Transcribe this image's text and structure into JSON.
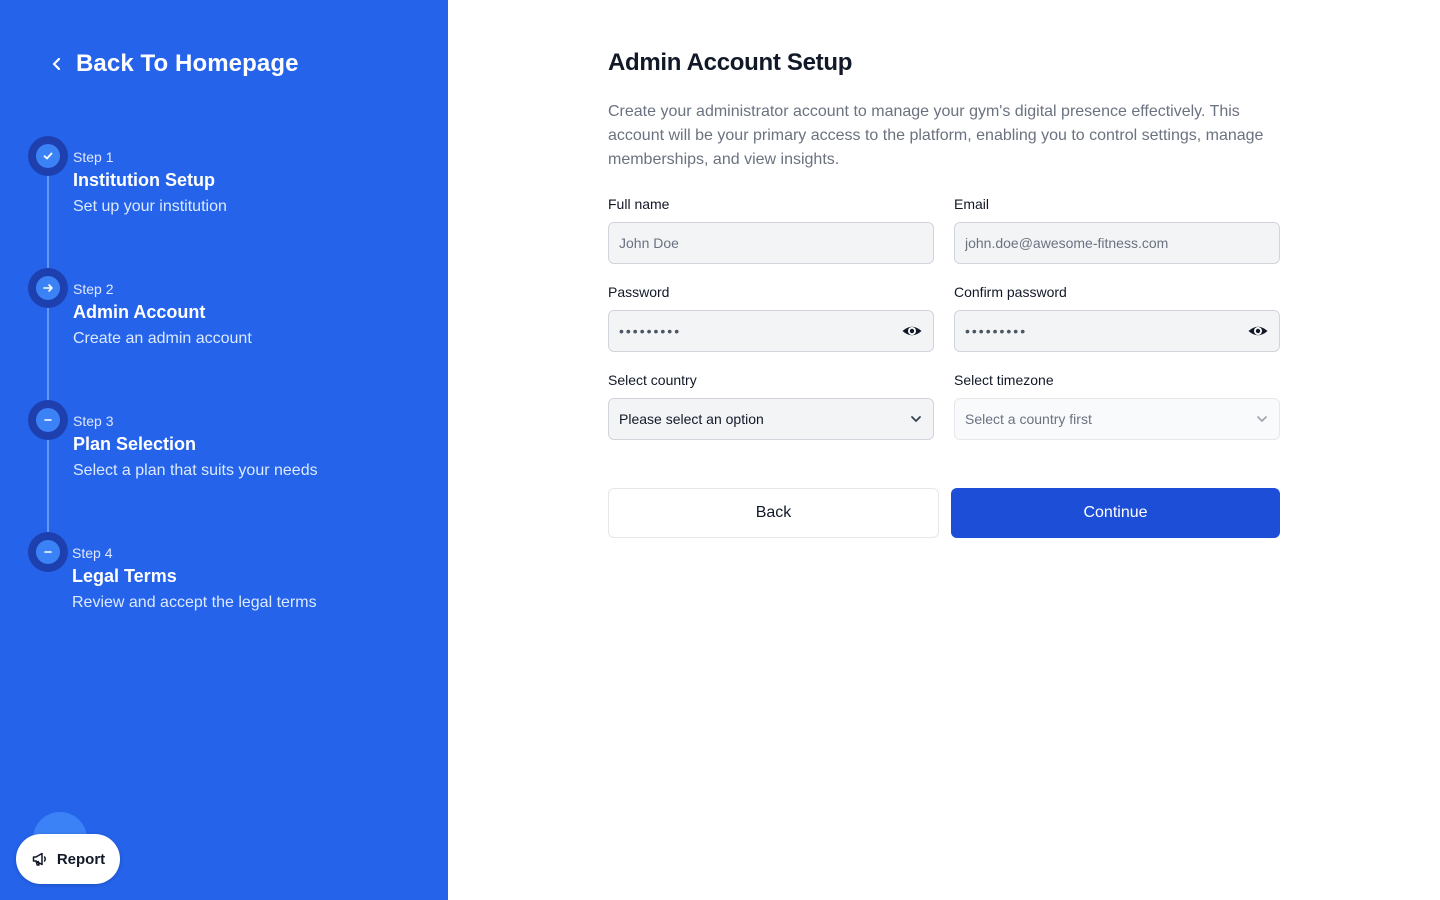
{
  "sidebar": {
    "back_link": "Back To Homepage",
    "steps": [
      {
        "number": "Step 1",
        "title": "Institution Setup",
        "description": "Set up your institution",
        "state": "completed",
        "icon": "check-icon"
      },
      {
        "number": "Step 2",
        "title": "Admin Account",
        "description": "Create an admin account",
        "state": "current",
        "icon": "arrow-right-icon"
      },
      {
        "number": "Step 3",
        "title": "Plan Selection",
        "description": "Select a plan that suits your needs",
        "state": "pending",
        "icon": "minus-icon"
      },
      {
        "number": "Step 4",
        "title": "Legal Terms",
        "description": "Review and accept the legal terms",
        "state": "pending",
        "icon": "minus-icon"
      }
    ]
  },
  "report_button": {
    "label": "Report",
    "icon": "megaphone-icon"
  },
  "main": {
    "title": "Admin Account Setup",
    "intro": "Create your administrator account to manage your gym's digital presence effectively. This account will be your primary access to the platform, enabling you to control settings, manage memberships, and view insights.",
    "fields": {
      "full_name": {
        "label": "Full name",
        "placeholder": "John Doe",
        "value": ""
      },
      "email": {
        "label": "Email",
        "placeholder": "john.doe@awesome-fitness.com",
        "value": ""
      },
      "password": {
        "label": "Password",
        "masked": "•••••••••"
      },
      "confirm_password": {
        "label": "Confirm password",
        "masked": "•••••••••"
      },
      "country": {
        "label": "Select country",
        "selected": "Please select an option"
      },
      "timezone": {
        "label": "Select timezone",
        "selected": "Select a country first"
      }
    },
    "buttons": {
      "back": "Back",
      "continue": "Continue"
    }
  },
  "colors": {
    "sidebar_bg": "#2563eb",
    "primary_button": "#1d4ed8",
    "step_ring": "#1e40af"
  }
}
